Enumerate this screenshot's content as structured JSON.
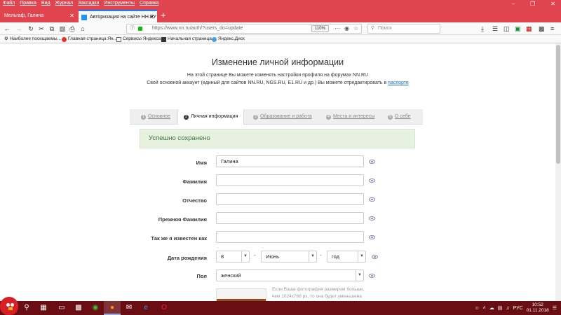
{
  "menubar": {
    "items": [
      "Файл",
      "Правка",
      "Вид",
      "Журнал",
      "Закладки",
      "Инструменты",
      "Справка"
    ],
    "minimize": "–",
    "maximize": "❐",
    "close": "✕"
  },
  "tabs": [
    {
      "label": "Мельгаф, Галина",
      "close": "✕"
    },
    {
      "label": "Авторизация на сайте НН.РУ",
      "close": "✕"
    }
  ],
  "newtab": "+",
  "nav": {
    "url": "https://www.nn.ru/auth/?users_do=update",
    "zoom": "110%",
    "search_placeholder": "Поиск",
    "icons": [
      "back-icon",
      "forward-icon",
      "reload-icon",
      "cut-icon",
      "copy-icon",
      "paste-icon",
      "print-icon",
      "home-icon",
      "download-icon",
      "library-icon",
      "sidebar-icon",
      "extension-icon",
      "menu-icon"
    ]
  },
  "bookmarks": [
    "Наиболее посещаемы...",
    "Главная страница Ян...",
    "Сервисы Яндекса",
    "Начальная страница",
    "Яндекс.Диск"
  ],
  "page": {
    "title": "Изменение личной информации",
    "desc_line1": "На этой странице Вы можете изменять настройки профиля на форумах NN.RU",
    "desc_line2": "Свой основной аккаунт (единый для сайтов NN.RU, NGS.RU, E1.RU и др.) Вы можете отредактировать в",
    "desc_link": "паспорте"
  },
  "steps": [
    {
      "num": "1",
      "label": "Основное"
    },
    {
      "num": "2",
      "label": "Личная информация"
    },
    {
      "num": "3",
      "label": "Образование и работа"
    },
    {
      "num": "4",
      "label": "Места и интересы"
    },
    {
      "num": "5",
      "label": "О себе"
    }
  ],
  "success": "Успешно сохранено",
  "form": {
    "name_label": "Имя",
    "name_value": "Галина",
    "surname_label": "Фамилия",
    "surname_value": "",
    "patronymic_label": "Отчество",
    "patronymic_value": "",
    "prev_surname_label": "Прежняя Фамилия",
    "prev_surname_value": "",
    "known_as_label": "Так же я известен как",
    "known_as_value": "",
    "birthdate_label": "Дата рождения",
    "birth_day": "8",
    "birth_month": "Июнь",
    "birth_year": "год",
    "dash": "-",
    "gender_label": "Пол",
    "gender_value": "женский",
    "photo_note": "Если Ваша фотография размером больше, чем 1024x768 px, то она будет уменьшена"
  },
  "taskbar": {
    "lang": "РУС",
    "time": "10:52",
    "date": "01.11.2018"
  }
}
